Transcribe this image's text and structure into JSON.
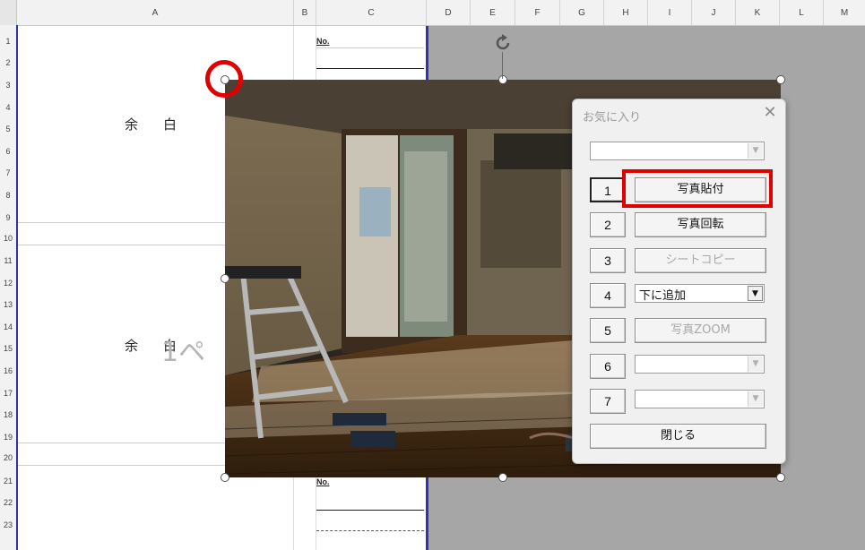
{
  "columns": [
    "A",
    "B",
    "C",
    "D",
    "E",
    "F",
    "G",
    "H",
    "I",
    "J",
    "K",
    "L",
    "M"
  ],
  "rows": [
    "1",
    "2",
    "3",
    "4",
    "5",
    "6",
    "7",
    "8",
    "9",
    "10",
    "11",
    "12",
    "13",
    "14",
    "15",
    "16",
    "17",
    "18",
    "19",
    "20",
    "21",
    "22",
    "23"
  ],
  "sheet": {
    "blank_label_top": "余白",
    "blank_label_middle": "余白",
    "no_label_top": "No.",
    "no_label_bottom": "No.",
    "overlay_text": "1ペ"
  },
  "dialog": {
    "title": "お気に入り",
    "close_symbol": "✕",
    "favorite_select_value": "",
    "rows": [
      {
        "num": "1",
        "label": "写真貼付",
        "kind": "button",
        "enabled": true
      },
      {
        "num": "2",
        "label": "写真回転",
        "kind": "button",
        "enabled": true
      },
      {
        "num": "3",
        "label": "シートコピー",
        "kind": "button",
        "enabled": false
      },
      {
        "num": "4",
        "label": "下に追加",
        "kind": "combo",
        "enabled": true
      },
      {
        "num": "5",
        "label": "写真ZOOM",
        "kind": "button",
        "enabled": false
      },
      {
        "num": "6",
        "label": "",
        "kind": "combo",
        "enabled": false
      },
      {
        "num": "7",
        "label": "",
        "kind": "combo",
        "enabled": false
      }
    ],
    "close_button_label": "閉じる"
  },
  "colors": {
    "highlight_red": "#e00000",
    "page_border_blue": "#2b35b8"
  },
  "icons": [
    "rotate-handle-icon",
    "close-icon",
    "dropdown-arrow-icon"
  ]
}
